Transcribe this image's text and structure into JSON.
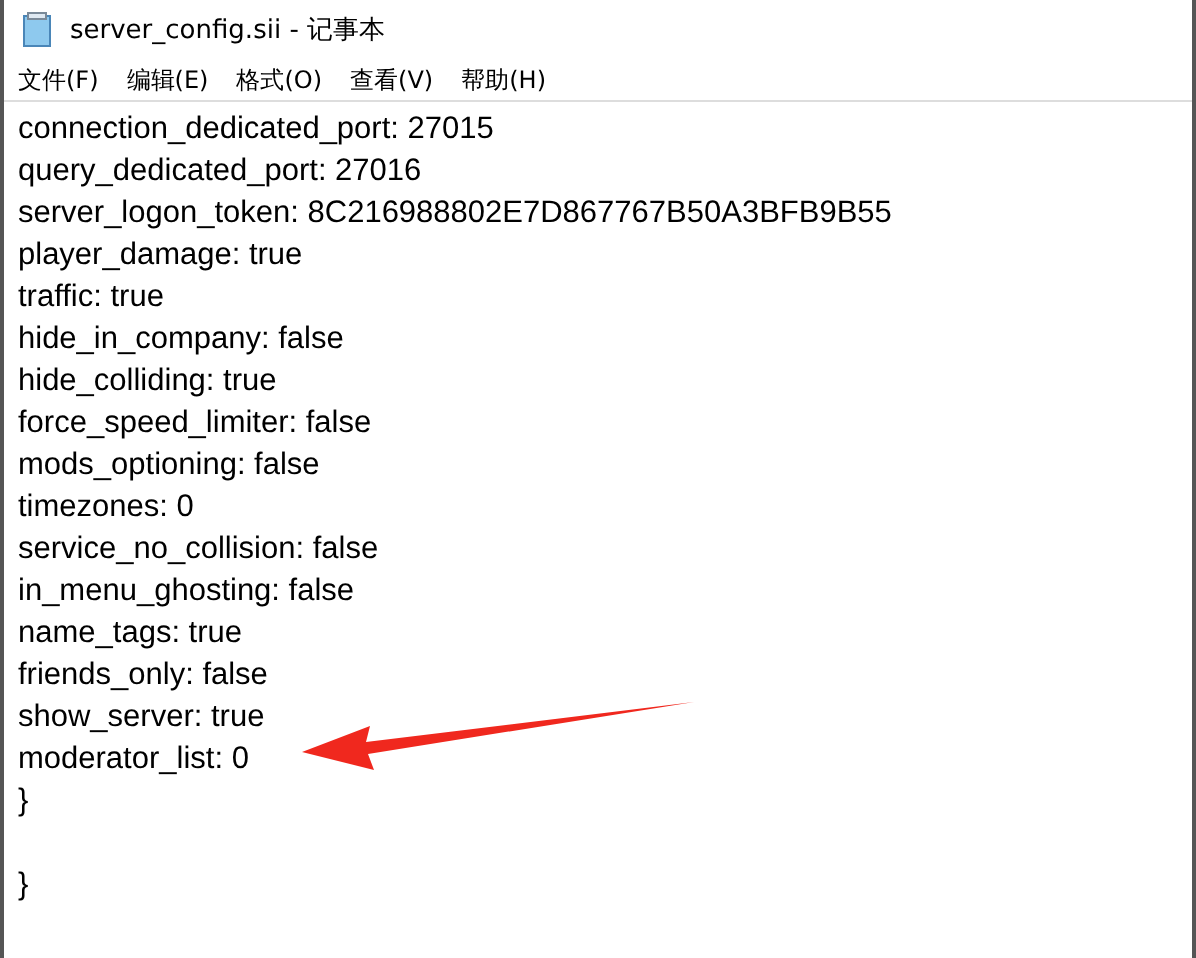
{
  "window": {
    "title": "server_config.sii - 记事本"
  },
  "menu": [
    "文件(F)",
    "编辑(E)",
    "格式(O)",
    "查看(V)",
    "帮助(H)"
  ],
  "lines": [
    "connection_dedicated_port: 27015",
    "query_dedicated_port: 27016",
    "server_logon_token: 8C216988802E7D867767B50A3BFB9B55",
    "player_damage: true",
    "traffic: true",
    "hide_in_company: false",
    "hide_colliding: true",
    "force_speed_limiter: false",
    "mods_optioning: false",
    "timezones: 0",
    "service_no_collision: false",
    "in_menu_ghosting: false",
    "name_tags: true",
    "friends_only: false",
    "show_server: true",
    "moderator_list: 0",
    "}"
  ],
  "lines_after_blank_line": [
    "}"
  ]
}
